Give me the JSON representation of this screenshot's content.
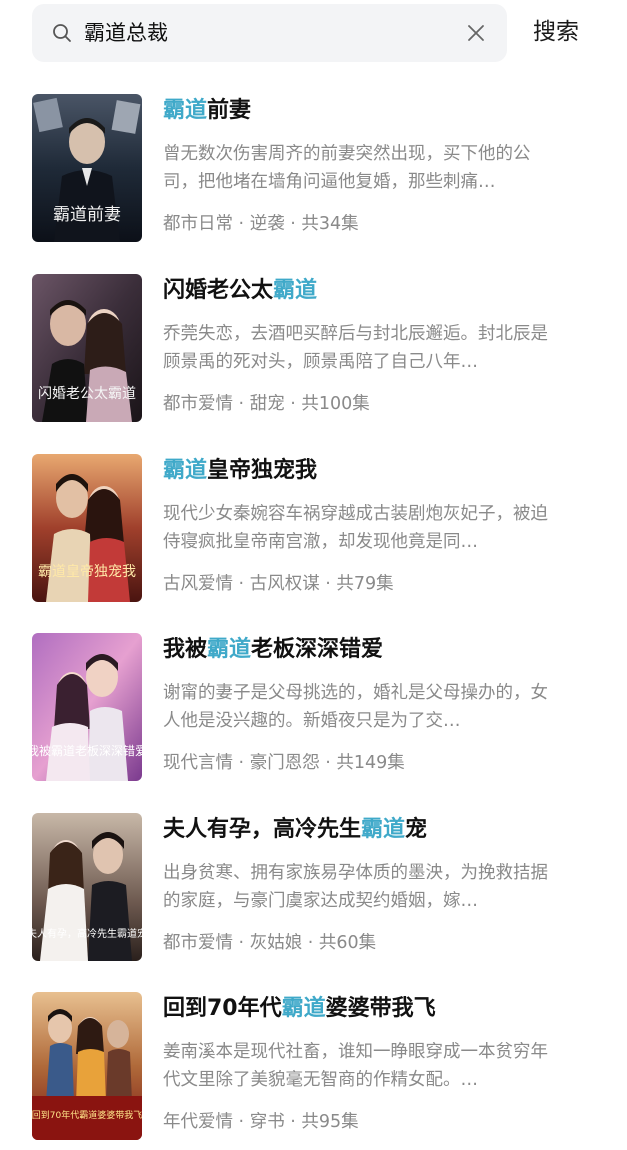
{
  "search": {
    "query": "霸道总裁",
    "button_label": "搜索"
  },
  "colors": {
    "highlight": "#3fa9c9",
    "search_bg": "#f3f4f6",
    "muted_text": "#8a8a8a"
  },
  "results": [
    {
      "title_before": "",
      "title_highlight": "霸道",
      "title_after": "前妻",
      "description": "曾无数次伤害周齐的前妻突然出现，买下他的公司，把他堵在墙角问逼他复婚，那些刺痛…",
      "meta": "都市日常 · 逆袭 · 共34集",
      "poster_text": "霸道前妻"
    },
    {
      "title_before": "闪婚老公太",
      "title_highlight": "霸道",
      "title_after": "",
      "description": "乔莞失恋，去酒吧买醉后与封北辰邂逅。封北辰是顾景禹的死对头，顾景禹陪了自己八年…",
      "meta": "都市爱情 · 甜宠 · 共100集",
      "poster_text": "闪婚老公太霸道"
    },
    {
      "title_before": "",
      "title_highlight": "霸道",
      "title_after": "皇帝独宠我",
      "description": "现代少女秦婉容车祸穿越成古装剧炮灰妃子，被迫侍寝疯批皇帝南宫澈，却发现他竟是同…",
      "meta": "古风爱情 · 古风权谋 · 共79集",
      "poster_text": "霸道皇帝独宠我"
    },
    {
      "title_before": "我被",
      "title_highlight": "霸道",
      "title_after": "老板深深错爱",
      "description": "谢甯的妻子是父母挑选的，婚礼是父母操办的，女人他是没兴趣的。新婚夜只是为了交…",
      "meta": "现代言情 · 豪门恩怨 · 共149集",
      "poster_text": "我被霸道老板深深错爱"
    },
    {
      "title_before": "夫人有孕，高冷先生",
      "title_highlight": "霸道",
      "title_after": "宠",
      "description": "出身贫寒、拥有家族易孕体质的墨泱，为挽救拮据的家庭，与豪门虞家达成契约婚姻，嫁…",
      "meta": "都市爱情 · 灰姑娘 · 共60集",
      "poster_text": "夫人有孕，高冷先生霸道宠"
    },
    {
      "title_before": "回到70年代",
      "title_highlight": "霸道",
      "title_after": "婆婆带我飞",
      "description": "姜南溪本是现代社畜，谁知一睁眼穿成一本贫穷年代文里除了美貌毫无智商的作精女配。…",
      "meta": "年代爱情 · 穿书 · 共95集",
      "poster_text": "回到70年代霸道婆婆带我飞"
    }
  ]
}
